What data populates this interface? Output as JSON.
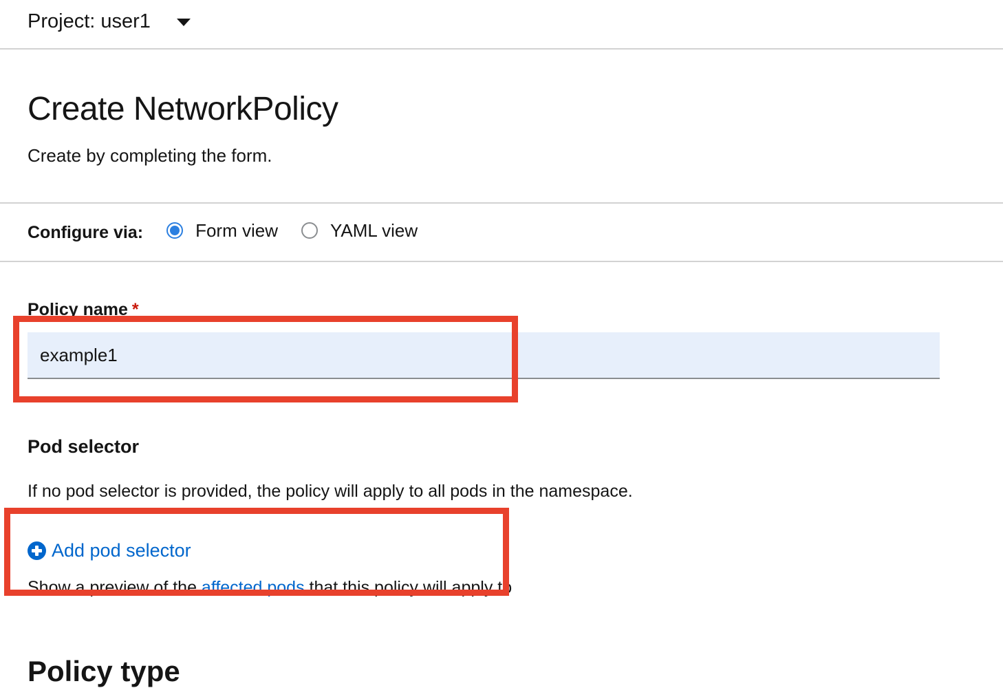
{
  "project_bar": {
    "label": "Project: user1",
    "caret_icon": "caret-down-icon"
  },
  "header": {
    "title": "Create NetworkPolicy",
    "description": "Create by completing the form."
  },
  "configure": {
    "label": "Configure via:",
    "options": [
      {
        "label": "Form view",
        "selected": true
      },
      {
        "label": "YAML view",
        "selected": false
      }
    ]
  },
  "policy_name": {
    "label": "Policy name",
    "required_marker": "*",
    "value": "example1"
  },
  "pod_selector": {
    "heading": "Pod selector",
    "help_text": "If no pod selector is provided, the policy will apply to all pods in the namespace.",
    "add_label": "Add pod selector",
    "add_icon": "plus-circle-icon",
    "preview_prefix": "Show a preview of the ",
    "preview_link": "affected pods",
    "preview_suffix": " that this policy will apply to"
  },
  "next_section": {
    "heading": "Policy type"
  },
  "colors": {
    "link": "#0066cc",
    "radio_selected": "#2b7fe0",
    "input_background": "#e7effb",
    "required": "#c9190b",
    "annotation_box": "#e8412c"
  }
}
